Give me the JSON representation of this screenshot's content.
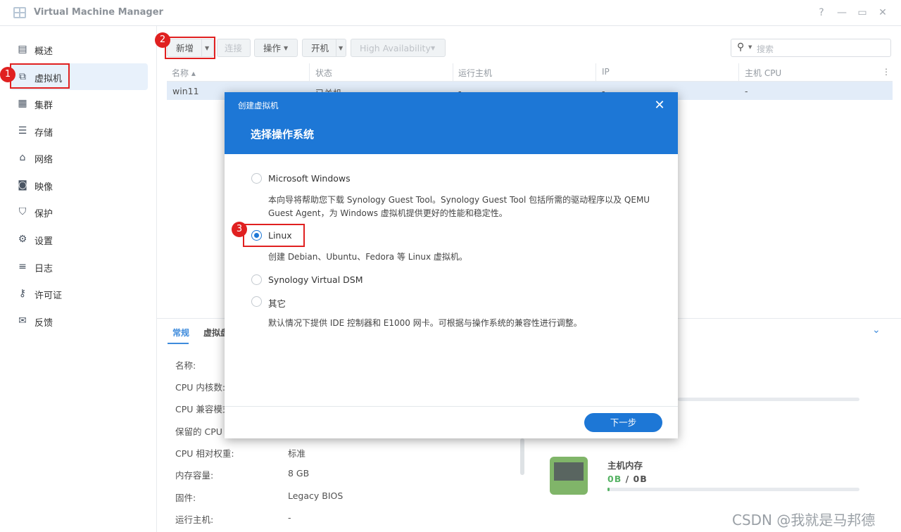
{
  "app": {
    "title": "Virtual Machine Manager"
  },
  "window_controls": [
    "?",
    "—",
    "▭",
    "✕"
  ],
  "sidebar": {
    "items": [
      {
        "label": "概述",
        "icon": "overview-icon"
      },
      {
        "label": "虚拟机",
        "icon": "vm-icon",
        "active": true
      },
      {
        "label": "集群",
        "icon": "cluster-icon"
      },
      {
        "label": "存储",
        "icon": "storage-icon"
      },
      {
        "label": "网络",
        "icon": "network-icon"
      },
      {
        "label": "映像",
        "icon": "image-icon"
      },
      {
        "label": "保护",
        "icon": "shield-icon"
      },
      {
        "label": "设置",
        "icon": "gear-icon"
      },
      {
        "label": "日志",
        "icon": "log-icon"
      },
      {
        "label": "许可证",
        "icon": "key-icon"
      },
      {
        "label": "反馈",
        "icon": "mail-icon"
      }
    ]
  },
  "toolbar": {
    "new": "新增",
    "connect": "连接",
    "action": "操作",
    "power_on": "开机",
    "ha": "High Availability",
    "search_placeholder": "搜索"
  },
  "grid": {
    "columns": [
      "名称",
      "状态",
      "运行主机",
      "IP",
      "主机 CPU"
    ],
    "rows": [
      {
        "name": "win11",
        "status": "已关机",
        "host": "-",
        "ip": "-",
        "cpu": "-"
      }
    ]
  },
  "detail": {
    "tabs": [
      "常规",
      "虚拟盘"
    ],
    "fields": [
      {
        "label": "名称:",
        "value": ""
      },
      {
        "label": "CPU 内核数:",
        "value": ""
      },
      {
        "label": "CPU 兼容模式",
        "value": ""
      },
      {
        "label": "保留的 CPU 线",
        "value": ""
      },
      {
        "label": "CPU 相对权重:",
        "value": "标准"
      },
      {
        "label": "内存容量:",
        "value": "8 GB"
      },
      {
        "label": "固件:",
        "value": "Legacy BIOS"
      },
      {
        "label": "运行主机:",
        "value": "-"
      }
    ],
    "host_memory": {
      "title": "主机内存",
      "used": "0",
      "used_unit": "B",
      "sep": " / ",
      "total": "0",
      "total_unit": "B",
      "fraction": 0.0
    }
  },
  "modal": {
    "small_title": "创建虚拟机",
    "heading": "选择操作系统",
    "options": [
      {
        "label": "Microsoft Windows",
        "selected": false,
        "desc": "本向导将帮助您下载 Synology Guest Tool。Synology Guest Tool 包括所需的驱动程序以及 QEMU Guest Agent，为 Windows 虚拟机提供更好的性能和稳定性。"
      },
      {
        "label": "Linux",
        "selected": true,
        "desc": "创建 Debian、Ubuntu、Fedora 等 Linux 虚拟机。"
      },
      {
        "label": "Synology Virtual DSM",
        "selected": false,
        "desc": ""
      },
      {
        "label": "其它",
        "selected": false,
        "desc": "默认情况下提供 IDE 控制器和 E1000 网卡。可根据与操作系统的兼容性进行调整。"
      }
    ],
    "next": "下一步"
  },
  "annotations": [
    "1",
    "2",
    "3"
  ],
  "watermark": "CSDN @我就是马邦德",
  "colors": {
    "accent": "#1d77d6",
    "annotation": "#e02020",
    "selected_row": "#dde9f7"
  }
}
